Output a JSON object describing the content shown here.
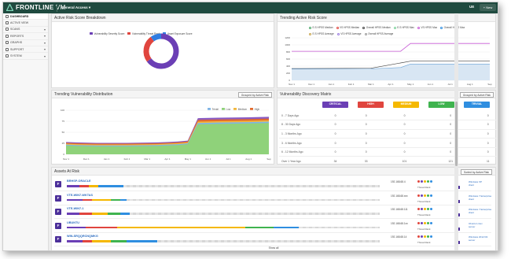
{
  "topbar": {
    "brand_bold": "FRONTLINE",
    "brand_light": " VM",
    "account": "General Access",
    "user": "UE",
    "new_label": "New"
  },
  "sidebar": {
    "items": [
      {
        "label": "DASHBOARD",
        "active": true,
        "chev": false
      },
      {
        "label": "ACTIVE VIEW",
        "active": false,
        "chev": false
      },
      {
        "label": "SCANS",
        "active": false,
        "chev": true
      },
      {
        "label": "REPORTS",
        "active": false,
        "chev": true
      },
      {
        "label": "GRAPHS",
        "active": false,
        "chev": true
      },
      {
        "label": "SUPPORT",
        "active": false,
        "chev": true
      },
      {
        "label": "SYSTEM",
        "active": false,
        "chev": true
      }
    ]
  },
  "breakdown": {
    "title": "Active Risk Score Breakdown",
    "legend": [
      "Vulnerability Severity Score",
      "Vulnerability Threat Rank",
      "Asset Exposure Score"
    ],
    "colors": [
      "#6b3fb5",
      "#e0453e",
      "#2f7de1"
    ],
    "values": [
      65,
      25,
      10
    ]
  },
  "trending_score": {
    "title": "Trending Active Risk Score",
    "legend": [
      "E.S HPSS Median",
      "VS HPSS Median",
      "Overall HPSS Median",
      "E.S HPSS Max",
      "VS HPSS Max",
      "Overall HPSS Max",
      "E.S HPSS Average",
      "VS HPSS Average",
      "Overall HPSS Average"
    ],
    "yticks": [
      "1200",
      "1000",
      "800",
      "600",
      "400",
      "200",
      "0"
    ],
    "xticks": [
      "Nov 1",
      "Dec 1",
      "Jan 1",
      "Feb 1",
      "Mar 1",
      "Apr 1",
      "May 1",
      "Jun 1",
      "Jul 1",
      "Aug 1",
      "Sep"
    ]
  },
  "trending_dist": {
    "title": "Trending Vulnerability Distribution",
    "group_btn": "Grouped by Active Risk",
    "legend": [
      "Trivial",
      "Low",
      "Medium",
      "High",
      "Critical"
    ],
    "colors": [
      "#7fb4e6",
      "#8fd27a",
      "#f3b73b",
      "#e36b2c",
      "#8a5bc3"
    ],
    "yticks": [
      "100",
      "75",
      "50",
      "25",
      "0"
    ],
    "xticks": [
      "Nov 1",
      "Dec 1",
      "Jan 1",
      "Feb 1",
      "Mar 1",
      "Apr 1",
      "May 1",
      "Jun 1",
      "Jul 1",
      "Aug 1",
      "Sep"
    ]
  },
  "matrix": {
    "title": "Vulnerability Discovery Matrix",
    "group_btn": "Grouped by Active Risk",
    "headers": [
      {
        "label": "CRITICAL",
        "color": "#6b3fb5"
      },
      {
        "label": "HIGH",
        "color": "#e0453e"
      },
      {
        "label": "MEDIUM",
        "color": "#f5b800"
      },
      {
        "label": "LOW",
        "color": "#3fb34f"
      },
      {
        "label": "TRIVIAL",
        "color": "#2f8ee0"
      }
    ],
    "rows": [
      {
        "label": "0 - 7 Days Ago",
        "vals": [
          "0",
          "0",
          "0",
          "0",
          "0"
        ]
      },
      {
        "label": "8 - 30 Days Ago",
        "vals": [
          "0",
          "0",
          "0",
          "0",
          "0"
        ]
      },
      {
        "label": "1 - 3 Months Ago",
        "vals": [
          "0",
          "0",
          "0",
          "0",
          "0"
        ]
      },
      {
        "label": "3 - 6 Months Ago",
        "vals": [
          "0",
          "0",
          "0",
          "0",
          "0"
        ]
      },
      {
        "label": "6 - 12 Months Ago",
        "vals": [
          "0",
          "0",
          "0",
          "0",
          "0"
        ]
      },
      {
        "label": "Over 1 Year Ago",
        "vals": [
          "34",
          "33",
          "101",
          "121",
          "11"
        ]
      }
    ]
  },
  "assets": {
    "title": "Assets At Risk",
    "sort_btn": "Sorted by Active Risk",
    "show_all": "Show all",
    "rows": [
      {
        "grade": "F",
        "name": "BRHSP-ORACLE",
        "ip": "192.168.68.4",
        "threat": "Threat Rank",
        "os": [
          "Windows XP",
          "client"
        ],
        "bars": [
          [
            "#6b3fb5",
            4
          ],
          [
            "#e0453e",
            3
          ],
          [
            "#f5b800",
            3
          ],
          [
            "#2f8ee0",
            8
          ]
        ]
      },
      {
        "grade": "F",
        "name": "VTE-WIN7-WKTAS",
        "ip": "192.168.68.xxx",
        "threat": "Threat Rank",
        "os": [
          "Windows 7 Enterprise",
          "client"
        ],
        "bars": [
          [
            "#6b3fb5",
            5
          ],
          [
            "#e0453e",
            3
          ],
          [
            "#f5b800",
            6
          ],
          [
            "#3fb34f",
            3
          ],
          [
            "#2f8ee0",
            2
          ]
        ]
      },
      {
        "grade": "F",
        "name": "VTE-WIN7-1",
        "ip": "192.168.68.111",
        "threat": "Threat Rank",
        "os": [
          "Windows 7 Enterprise",
          "client"
        ],
        "bars": [
          [
            "#6b3fb5",
            4
          ],
          [
            "#e0453e",
            4
          ],
          [
            "#f5b800",
            5
          ],
          [
            "#3fb34f",
            4
          ],
          [
            "#2f8ee0",
            3
          ]
        ]
      },
      {
        "grade": "F",
        "name": "UBUNTU",
        "ip": "192.168.68.1xx",
        "threat": "Threat Rank",
        "os": [
          "Ubuntu Linux",
          "server"
        ],
        "bars": [
          [
            "#6b3fb5",
            6
          ],
          [
            "#e0453e",
            10
          ],
          [
            "#f5b800",
            41
          ],
          [
            "#3fb34f",
            9
          ],
          [
            "#2f8ee0",
            8
          ]
        ]
      },
      {
        "grade": "F",
        "name": "WIN-SRQQRCNQMKG",
        "ip": "192.168.68.14",
        "threat": "Threat Rank",
        "os": [
          "Windows 2012 R2",
          "server"
        ],
        "bars": [
          [
            "#6b3fb5",
            5
          ],
          [
            "#e0453e",
            3
          ],
          [
            "#f5b800",
            6
          ],
          [
            "#3fb34f",
            5
          ],
          [
            "#2f8ee0",
            10
          ]
        ]
      }
    ]
  }
}
